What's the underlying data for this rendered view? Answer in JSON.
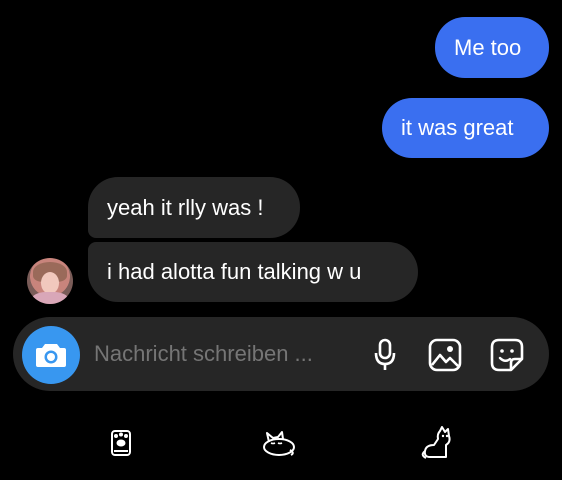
{
  "messages": [
    {
      "text": "Me too",
      "direction": "outgoing"
    },
    {
      "text": "it was great",
      "direction": "outgoing"
    },
    {
      "text": "yeah it rlly was !",
      "direction": "incoming"
    },
    {
      "text": "i had alotta fun talking w u",
      "direction": "incoming"
    }
  ],
  "composer": {
    "placeholder": "Nachricht schreiben ...",
    "buttons": [
      "camera-icon",
      "microphone-icon",
      "gallery-icon",
      "sticker-icon"
    ]
  },
  "bottom_bar": {
    "icons": [
      "paw-icon",
      "sleeping-cat-icon",
      "sitting-cat-icon"
    ]
  },
  "colors": {
    "background": "#000000",
    "outgoing_bubble": "#3a6ff0",
    "incoming_bubble": "#262626",
    "camera_button": "#3897f0",
    "placeholder_text": "#9a9a9a"
  }
}
